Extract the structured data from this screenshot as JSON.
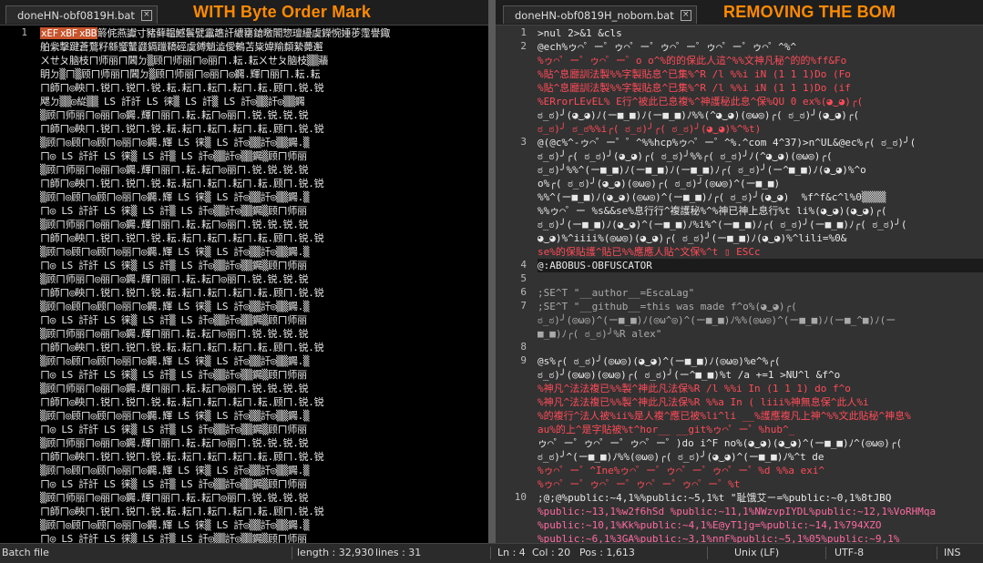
{
  "left_pane": {
    "tab_label": "doneHN-obf0819H.bat",
    "banner": "WITH Byte Order Mark",
    "line_numbers": [
      "1"
    ],
    "bom_tokens": [
      "xEF",
      "xBF",
      "xBB"
    ],
    "rows": [
      "䉁侂燕讞寸豬藓韞鱤鬟甓靁趭訐繷罋鎗曒閣惣璮纋虞鑅惋娷荹霪譽鋷",
      "舶繠擊踺蒼鶩籽緜蠁鼜鼝鎘躐鞽硜虞鎛魈澁僾鶇苫粊媁羭纇縶薨邂",
      "ㄨㄝㄆ脑枝ㄇ师丽ㄇ閪ㄉ▒顾ㄇ师丽ㄇ◎丽ㄇ.耘.耘ㄨㄝㄆ脑枝▒▒蘠",
      "眀ㄉ▒ㄇ▒顾ㄇ师丽ㄇ閪ㄉ▒顾ㄇ师丽ㄇ◎丽ㄇ◎鐊.輝ㄇ丽ㄇ.耘.耘",
      "ㄇ師ㄇ◎眏ㄇ.锐ㄇ.锐ㄇ.锐.耘.耘ㄇ.耘ㄇ.耘ㄇ.耘.顾ㄇ.锐.锐",
      "飔ㄉ▒▒◎緃▒▒ LS 訐訐 LS 徕▒ LS 訐▒ LS 訐◎▒▒訐◎▒▒鐊",
      "▒顾ㄇ师丽ㄇ◎丽ㄇ◎鐊.輝ㄇ丽ㄇ.耘.耘ㄇ◎丽ㄇ.锐.锐.锐.锐",
      "ㄇ師ㄇ◎眏ㄇ.锐ㄇ.锐ㄇ.锐.耘.耘ㄇ.耘ㄇ.耘ㄇ.耘.顾ㄇ.锐.锐",
      "▒顾ㄇ◎顾ㄇ◎顾ㄇ◎丽ㄇ◎鐊.輝 LS 徕▒ LS 訐◎▒▒訐◎▒▒鐊.▒",
      "ㄇ◎ LS 訐訐 LS 徕▒ LS 訐▒ LS 訐◎▒▒訐◎▒▒鐊▒顾ㄇ师丽",
      "▒顾ㄇ师丽ㄇ◎丽ㄇ◎鐊.輝ㄇ丽ㄇ.耘.耘ㄇ◎丽ㄇ.锐.锐.锐.锐",
      "ㄇ師ㄇ◎眏ㄇ.锐ㄇ.锐ㄇ.锐.耘.耘ㄇ.耘ㄇ.耘ㄇ.耘.顾ㄇ.锐.锐",
      "▒顾ㄇ◎顾ㄇ◎顾ㄇ◎丽ㄇ◎鐊.輝 LS 徕▒ LS 訐◎▒▒訐◎▒▒鐊.▒",
      "ㄇ◎ LS 訐訐 LS 徕▒ LS 訐▒ LS 訐◎▒▒訐◎▒▒鐊▒顾ㄇ师丽",
      "▒顾ㄇ师丽ㄇ◎丽ㄇ◎鐊.輝ㄇ丽ㄇ.耘.耘ㄇ◎丽ㄇ.锐.锐.锐.锐",
      "ㄇ師ㄇ◎眏ㄇ.锐ㄇ.锐ㄇ.锐.耘.耘ㄇ.耘ㄇ.耘ㄇ.耘.顾ㄇ.锐.锐",
      "▒顾ㄇ◎顾ㄇ◎顾ㄇ◎丽ㄇ◎鐊.輝 LS 徕▒ LS 訐◎▒▒訐◎▒▒鐊.▒",
      "ㄇ◎ LS 訐訐 LS 徕▒ LS 訐▒ LS 訐◎▒▒訐◎▒▒鐊▒顾ㄇ师丽",
      "▒顾ㄇ师丽ㄇ◎丽ㄇ◎鐊.輝ㄇ丽ㄇ.耘.耘ㄇ◎丽ㄇ.锐.锐.锐.锐",
      "ㄇ師ㄇ◎眏ㄇ.锐ㄇ.锐ㄇ.锐.耘.耘ㄇ.耘ㄇ.耘ㄇ.耘.顾ㄇ.锐.锐",
      "▒顾ㄇ◎顾ㄇ◎顾ㄇ◎丽ㄇ◎鐊.輝 LS 徕▒ LS 訐◎▒▒訐◎▒▒鐊.▒",
      "ㄇ◎ LS 訐訐 LS 徕▒ LS 訐▒ LS 訐◎▒▒訐◎▒▒鐊▒顾ㄇ师丽",
      "▒顾ㄇ师丽ㄇ◎丽ㄇ◎鐊.輝ㄇ丽ㄇ.耘.耘ㄇ◎丽ㄇ.锐.锐.锐.锐",
      "ㄇ師ㄇ◎眏ㄇ.锐ㄇ.锐ㄇ.锐.耘.耘ㄇ.耘ㄇ.耘ㄇ.耘.顾ㄇ.锐.锐",
      "▒顾ㄇ◎顾ㄇ◎顾ㄇ◎丽ㄇ◎鐊.輝 LS 徕▒ LS 訐◎▒▒訐◎▒▒鐊.▒",
      "ㄇ◎ LS 訐訐 LS 徕▒ LS 訐▒ LS 訐◎▒▒訐◎▒▒鐊▒顾ㄇ师丽",
      "▒顾ㄇ师丽ㄇ◎丽ㄇ◎鐊.輝ㄇ丽ㄇ.耘.耘ㄇ◎丽ㄇ.锐.锐.锐.锐",
      "ㄇ師ㄇ◎眏ㄇ.锐ㄇ.锐ㄇ.锐.耘.耘ㄇ.耘ㄇ.耘ㄇ.耘.顾ㄇ.锐.锐",
      "▒顾ㄇ◎顾ㄇ◎顾ㄇ◎丽ㄇ◎鐊.輝 LS 徕▒ LS 訐◎▒▒訐◎▒▒鐊.▒",
      "ㄇ◎ LS 訐訐 LS 徕▒ LS 訐▒ LS 訐◎▒▒訐◎▒▒鐊▒顾ㄇ师丽",
      "▒顾ㄇ师丽ㄇ◎丽ㄇ◎鐊.輝ㄇ丽ㄇ.耘.耘ㄇ◎丽ㄇ.锐.锐.锐.锐",
      "ㄇ師ㄇ◎眏ㄇ.锐ㄇ.锐ㄇ.锐.耘.耘ㄇ.耘ㄇ.耘ㄇ.耘.顾ㄇ.锐.锐",
      "▒顾ㄇ◎顾ㄇ◎顾ㄇ◎丽ㄇ◎鐊.輝 LS 徕▒ LS 訐◎▒▒訐◎▒▒鐊.▒",
      "ㄇ◎ LS 訐訐 LS 徕▒ LS 訐▒ LS 訐◎▒▒訐◎▒▒鐊▒顾ㄇ师丽",
      "▒顾ㄇ师丽ㄇ◎丽ㄇ◎鐊.輝ㄇ丽ㄇ.耘.耘ㄇ◎丽ㄇ.锐.锐.锐.锐",
      "ㄇ師ㄇ◎眏ㄇ.锐ㄇ.锐ㄇ.锐.耘.耘ㄇ.耘ㄇ.耘ㄇ.耘.顾ㄇ.锐.锐",
      "▒顾ㄇ◎顾ㄇ◎顾ㄇ◎丽ㄇ◎鐊.輝 LS 徕▒ LS 訐◎▒▒訐◎▒▒鐊.▒",
      "ㄇ◎ LS 訐訐 LS 徕▒ LS 訐▒ LS 訐◎▒▒訐◎▒▒鐊▒顾ㄇ师丽"
    ]
  },
  "right_pane": {
    "tab_label": "doneHN-obf0819H_nobom.bat",
    "banner": "REMOVING THE BOM",
    "lines": [
      {
        "num": "1",
        "text": ">nul 2>&1 &cls",
        "cls": "r-white"
      },
      {
        "num": "2",
        "text": "@ech%ゥ⌒゜ー゜ゥ⌒゜ー゜ゥ⌒゜ー゜ゥ⌒゜ー゜ゥ⌒゜^%^",
        "cls": "r-white"
      },
      {
        "num": "",
        "text": "%ゥ⌒゜ー゜ゥ⌒゜ー゜o o^%的的保此人這^%%文神凡秘^的的%ff&Fo",
        "cls": "r-red"
      },
      {
        "num": "",
        "text": "%貼^息廳訓法製%%字製貼息^已集%^R /l %%i iN (1 1 1)Do (Fo",
        "cls": "r-red"
      },
      {
        "num": "",
        "text": "%貼^息廳訓法製%%字製貼息^已集%^R /l %%i iN (1 1 1)Do (if",
        "cls": "r-red"
      },
      {
        "num": "",
        "text": "%ERrorLEvEL% E行^被此已息複%^神護秘此息^保%QU 0 ex%(◕‿◕)╭(",
        "cls": "r-red"
      },
      {
        "num": "",
        "text": "ಠ_ಠ)╯(◕‿◕)ﾉ(ー■_■)ﾉ(ー■_■)ﾉ%%(^◕‿◕)(◎ω◎)╭( ಠ_ಠ)╯(◕‿◕)╭(",
        "cls": "r-white"
      },
      {
        "num": "",
        "text": "ಠ_ಠ)╯ ಠ_ಠ%%i╭( ಠ_ಠ)╯╭( ಠ_ಠ)╯(◕‿◕)%^%t)",
        "cls": "r-red"
      },
      {
        "num": "3",
        "text": "@(@c%^-ゥ⌒゜ー゜゜^%%hcp%ゥ⌒゜ー゜^%.^com 4^37)>n^UL&@ec%╭( ಠ_ಠ)╯(",
        "cls": "r-white"
      },
      {
        "num": "",
        "text": "ಠ_ಠ)╯╭( ಠ_ಠ)╯(◕‿◕)╭( ಠ_ಠ)╯%%╭( ಠ_ಠ)╯ﾉ(^◕‿◕)(◎ω◎)╭(",
        "cls": "r-white"
      },
      {
        "num": "",
        "text": "ಠ_ಠ)╯%%^(ー■_■)ﾉ(ー■_■)ﾉ(ー■_■)ﾉ╭( ಠ_ಠ)╯(ー^■_■)ﾉ(◕‿◕)%^o",
        "cls": "r-white"
      },
      {
        "num": "",
        "text": "o%╭( ಠ_ಠ)╯(◕‿◕)(◎ω◎)╭( ಠ_ಠ)╯(◎ω◎)^(ー■_■)",
        "cls": "r-white"
      },
      {
        "num": "",
        "text": "%%^(ー■_■)ﾉ(◕‿◕)(◎ω◎)^(ー■_■)ﾉ╭( ಠ_ಠ)╯(◕‿◕)  %f^f&c^l%0▒▒▒▒",
        "cls": "r-white"
      },
      {
        "num": "",
        "text": "%%ゥ⌒゜ー %s&&se%息行行^複護秘%^%神已神上息行%t li%(◕‿◕)(◕‿◕)╭(",
        "cls": "r-white"
      },
      {
        "num": "",
        "text": "ಠ_ಠ)╯(ー■_■)ﾉ(◕‿◕)^(ー■_■)ﾉ%i%^(ー■_■)ﾉ╭( ಠ_ಠ)╯(ー■_■)ﾉ╭( ಠ_ಠ)╯(",
        "cls": "r-white"
      },
      {
        "num": "",
        "text": "◕‿◕)%^iiii%(◎ω◎)(◕‿◕)╭( ಠ_ಠ)╯(ー■_■)ﾉ(◕‿◕)%^lili=%0&",
        "cls": "r-white"
      },
      {
        "num": "",
        "text": "se%的保貼護^貼已%%應應人貼^文保%^t ▯ ESCc",
        "cls": "r-red"
      },
      {
        "num": "4",
        "text": "@:ABOBUS-OBFUSCATOR",
        "cls": "r-white cur"
      },
      {
        "num": "5",
        "text": "",
        "cls": "r-white"
      },
      {
        "num": "6",
        "text": ";SE^T \"__author__=EscaLag\"",
        "cls": "r-grey"
      },
      {
        "num": "7",
        "text": ";SE^T \"__github__=this was made f^o%(◕‿◕)╭(",
        "cls": "r-grey"
      },
      {
        "num": "",
        "text": "ಠ_ಠ)╯(◎ω◎)^(ー■_■)ﾉ(◎ω^◎)^(ー■_■)ﾉ%%(◎ω◎)^(ー■_■)ﾉ(ー■_^■)ﾉ(ー",
        "cls": "r-grey"
      },
      {
        "num": "",
        "text": "■_■)ﾉ╭( ಠ_ಠ)╯%R alex\"",
        "cls": "r-grey"
      },
      {
        "num": "8",
        "text": "",
        "cls": "r-white"
      },
      {
        "num": "9",
        "text": "@s%╭( ಠ_ಠ)╯(◎ω◎)(◕‿◕)^(ー■_■)ﾉ(◎ω◎)%e^%╭(",
        "cls": "r-white"
      },
      {
        "num": "",
        "text": "ಠ_ಠ)╯(◎ω◎)(◎ω◎)╭( ಠ_ಠ)╯(ー^■_■)%t /a +=1 >NU^l &f^o",
        "cls": "r-white"
      },
      {
        "num": "",
        "text": "%神凡^法法複已%%製^神此凡法保%R /l %%i In (1 1 1) do f^o",
        "cls": "r-red"
      },
      {
        "num": "",
        "text": "%神凡^法法複已%%製^神此凡法保%R %%a In ( liii%神無息保^此人%i",
        "cls": "r-red"
      },
      {
        "num": "",
        "text": "%的複行^法人被%ii%是人複^應已被%li^li __%護應複凡上神^%%文此貼秘^神息%",
        "cls": "r-red"
      },
      {
        "num": "",
        "text": "au%的上^是字貼被%t^hor__ __git%ゥ⌒゜ー゜%hub^_",
        "cls": "r-red"
      },
      {
        "num": "",
        "text": "ゥ⌒゜ー゜ゥ⌒゜ー゜ゥ⌒゜ー゜)do i^F no%(◕‿◕)(◕‿◕)^(ー■_■)ﾉ^(◎ω◎)╭(",
        "cls": "r-white"
      },
      {
        "num": "",
        "text": "ಠ_ಠ)╯^(ー■_■)ﾉ%%(◎ω◎)╭( ಠ_ಠ)╯(◕‿◕)^(ー■_■)ﾉ%^t de",
        "cls": "r-white"
      },
      {
        "num": "",
        "text": "%ゥ⌒゜ー゜^Ine%ゥ⌒゜ー゜ゥ⌒゜ー゜ゥ⌒゜ー゜%d %%a exi^",
        "cls": "r-red"
      },
      {
        "num": "",
        "text": "%ゥ⌒゜ー゜ゥ⌒゜ー゜ゥ⌒゜ー゜ゥ⌒゜ー゜%t",
        "cls": "r-red"
      },
      {
        "num": "10",
        "text": ";@;@%public:~4,1%%public:~5,1%t \"耻饿艾ㄧ=%public:~0,1%8tJBQ",
        "cls": "r-white"
      },
      {
        "num": "",
        "text": "%public:~13,1%w2f6hSd %public:~11,1%NWzvpIYDL%public:~12,1%VoRHMqa",
        "cls": "r-pink"
      },
      {
        "num": "",
        "text": "%public:~10,1%Kk%public:~4,1%E@yT1jg=%public:~14,1%794XZO",
        "cls": "r-pink"
      },
      {
        "num": "",
        "text": "%public:~6,1%3GA%public:~3,1%nnF%public:~5,1%05%public:~9,1%",
        "cls": "r-pink"
      }
    ]
  },
  "status": {
    "file_type": "Batch file",
    "length": "length : 32,930",
    "lines": "lines : 31",
    "ln": "Ln : 4",
    "col": "Col : 20",
    "pos": "Pos : 1,613",
    "eol": "Unix (LF)",
    "encoding": "UTF-8",
    "mode": "INS"
  },
  "icons": {
    "tab_close": "close-icon"
  }
}
